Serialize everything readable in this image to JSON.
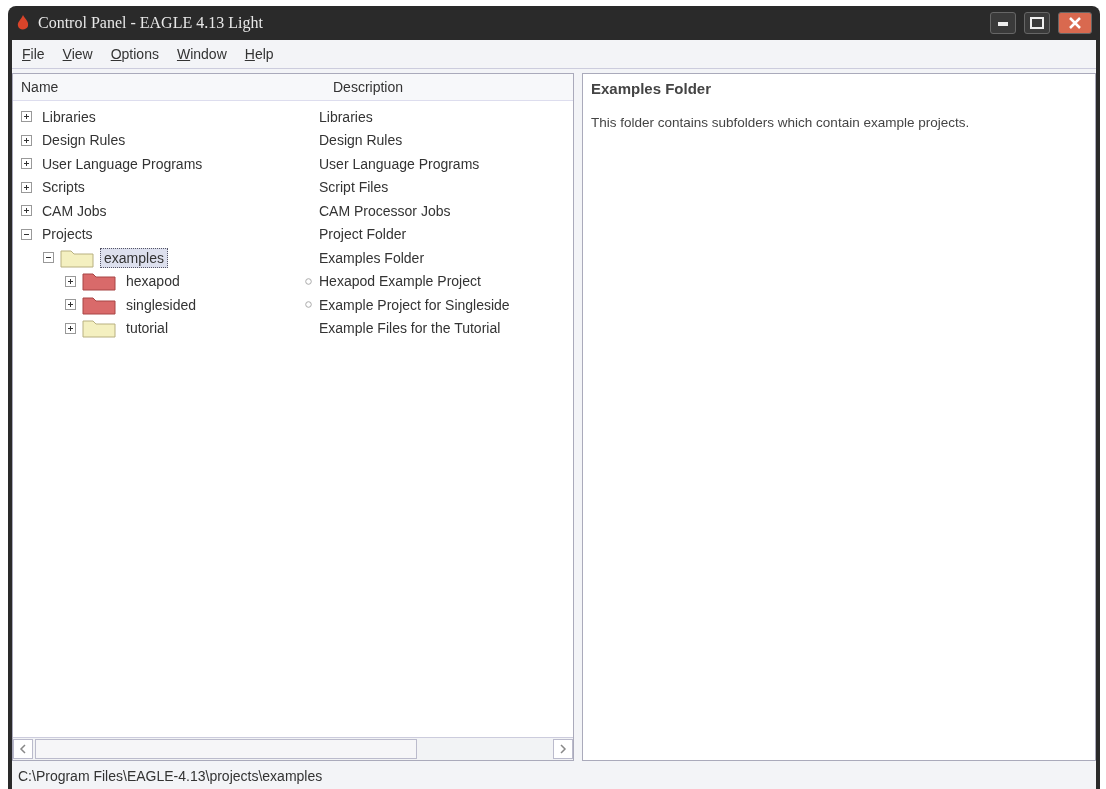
{
  "window": {
    "title": "Control Panel - EAGLE 4.13 Light"
  },
  "menu": [
    "File",
    "View",
    "Options",
    "Window",
    "Help"
  ],
  "tree": {
    "columns": [
      "Name",
      "Description"
    ],
    "items": [
      {
        "label": "Libraries",
        "description": "Libraries",
        "expanded": false,
        "selected": false,
        "dot": false
      },
      {
        "label": "Design Rules",
        "description": "Design Rules",
        "expanded": false,
        "selected": false,
        "dot": false
      },
      {
        "label": "User Language Programs",
        "description": "User Language Programs",
        "expanded": false,
        "selected": false,
        "dot": false
      },
      {
        "label": "Scripts",
        "description": "Script Files",
        "expanded": false,
        "selected": false,
        "dot": false
      },
      {
        "label": "CAM Jobs",
        "description": "CAM Processor Jobs",
        "expanded": false,
        "selected": false,
        "dot": false
      },
      {
        "label": "Projects",
        "description": "Project Folder",
        "expanded": true,
        "selected": false,
        "dot": false,
        "children": [
          {
            "label": "examples",
            "description": "Examples Folder",
            "kind": "folder",
            "expanded": true,
            "selected": true,
            "dot": false,
            "children": [
              {
                "label": "hexapod",
                "description": "Hexapod Example Project",
                "kind": "project",
                "expanded": false,
                "selected": false,
                "dot": true
              },
              {
                "label": "singlesided",
                "description": "Example Project for Singleside",
                "kind": "project",
                "expanded": false,
                "selected": false,
                "dot": true
              },
              {
                "label": "tutorial",
                "description": "Example Files for the Tutorial",
                "kind": "folder",
                "expanded": false,
                "selected": false,
                "dot": false
              }
            ]
          }
        ]
      }
    ]
  },
  "info": {
    "title": "Examples Folder",
    "text": "This folder contains subfolders which contain example projects."
  },
  "status_bar": "C:\\Program Files\\EAGLE-4.13\\projects\\examples"
}
